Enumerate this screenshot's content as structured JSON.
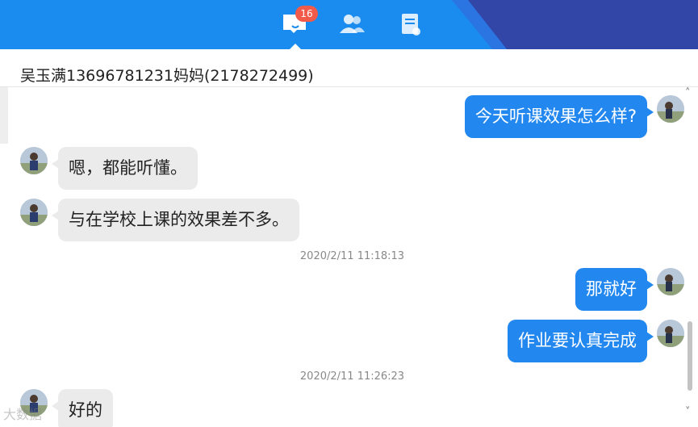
{
  "nav": {
    "unread_count": "16",
    "colors": {
      "bar": "#1a8cf0",
      "accent_dark": "#3246a8",
      "badge": "#f25a4a"
    }
  },
  "chat": {
    "title": "吴玉满13696781231妈妈(2178272499)"
  },
  "messages": [
    {
      "from": "me",
      "text": "今天听课效果怎么样?"
    },
    {
      "from": "other",
      "text": "嗯，都能听懂。"
    },
    {
      "from": "other",
      "text": "与在学校上课的效果差不多。"
    },
    {
      "timestamp": "2020/2/11 11:18:13"
    },
    {
      "from": "me",
      "text": "那就好"
    },
    {
      "from": "me",
      "text": "作业要认真完成"
    },
    {
      "timestamp": "2020/2/11 11:26:23"
    },
    {
      "from": "other",
      "text": "好的"
    }
  ],
  "watermark": "大数据"
}
